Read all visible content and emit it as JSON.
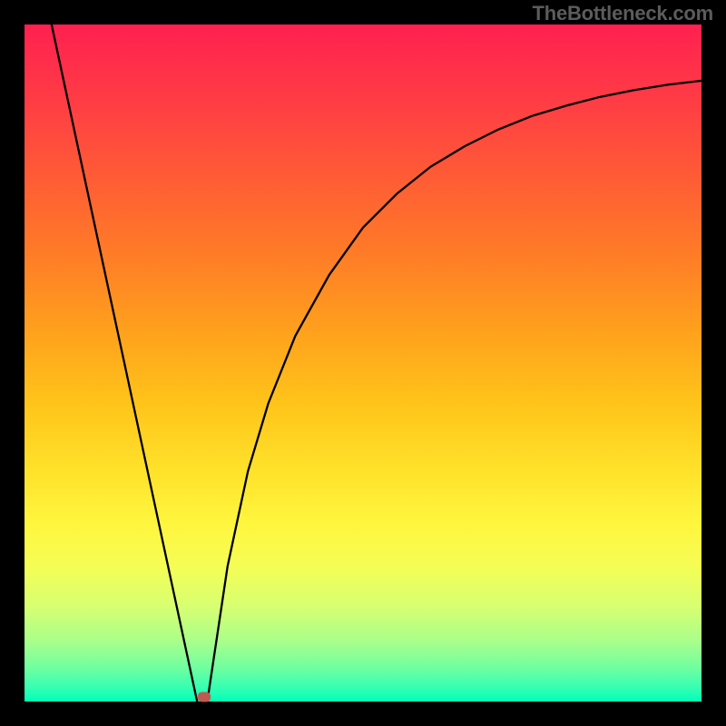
{
  "watermark": "TheBottleneck.com",
  "chart_data": {
    "type": "line",
    "title": "",
    "xlabel": "",
    "ylabel": "",
    "xlim": [
      0,
      100
    ],
    "ylim": [
      0,
      100
    ],
    "gradient_stops": [
      {
        "pos": 0,
        "color": "#ff2050"
      },
      {
        "pos": 12,
        "color": "#ff3e44"
      },
      {
        "pos": 22,
        "color": "#ff5a36"
      },
      {
        "pos": 34,
        "color": "#ff7c27"
      },
      {
        "pos": 46,
        "color": "#ffa31c"
      },
      {
        "pos": 56,
        "color": "#ffc41a"
      },
      {
        "pos": 66,
        "color": "#ffe22a"
      },
      {
        "pos": 74,
        "color": "#fff63f"
      },
      {
        "pos": 80,
        "color": "#f5fd55"
      },
      {
        "pos": 86,
        "color": "#d7ff71"
      },
      {
        "pos": 91,
        "color": "#aaff8a"
      },
      {
        "pos": 95,
        "color": "#70ff9f"
      },
      {
        "pos": 98,
        "color": "#34ffb2"
      },
      {
        "pos": 100,
        "color": "#00ffba"
      }
    ],
    "series": [
      {
        "name": "left-line",
        "x": [
          4,
          25.5
        ],
        "values": [
          100,
          0
        ]
      },
      {
        "name": "right-curve",
        "x": [
          27,
          30,
          33,
          36,
          40,
          45,
          50,
          55,
          60,
          65,
          70,
          75,
          80,
          85,
          90,
          95,
          100
        ],
        "values": [
          0,
          20,
          34,
          44,
          54,
          63,
          70,
          75,
          79,
          82,
          84.5,
          86.5,
          88,
          89.3,
          90.3,
          91.1,
          91.7
        ]
      }
    ],
    "marker": {
      "x": 26.5,
      "y": 0.7,
      "color": "#c05a50"
    }
  }
}
